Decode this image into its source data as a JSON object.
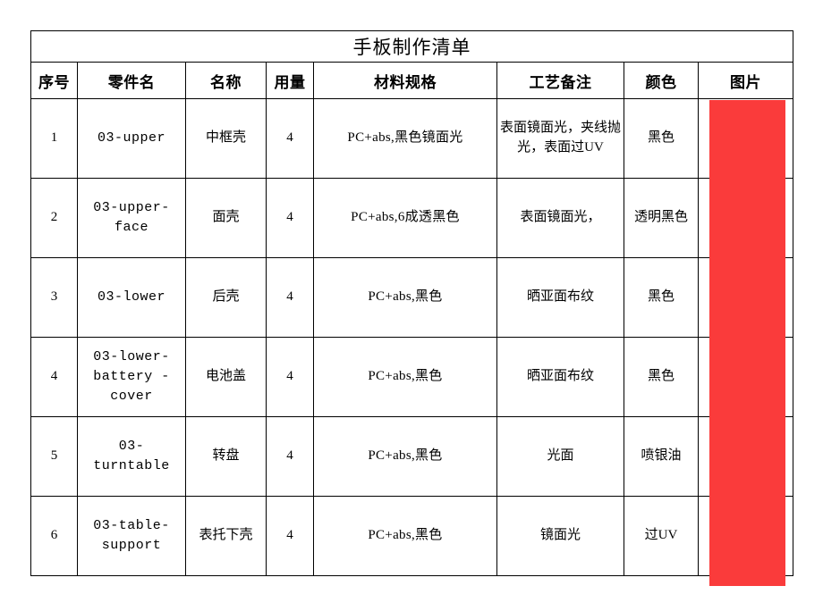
{
  "document": {
    "title": "手板制作清单"
  },
  "table": {
    "columns": [
      {
        "key": "index",
        "label": "序号",
        "name": "col-index"
      },
      {
        "key": "part_no",
        "label": "零件名",
        "name": "col-part-number"
      },
      {
        "key": "name",
        "label": "名称",
        "name": "col-name"
      },
      {
        "key": "qty",
        "label": "用量",
        "name": "col-quantity"
      },
      {
        "key": "material",
        "label": "材料规格",
        "name": "col-material-spec"
      },
      {
        "key": "process",
        "label": "工艺备注",
        "name": "col-process-note"
      },
      {
        "key": "color",
        "label": "颜色",
        "name": "col-color"
      },
      {
        "key": "picture",
        "label": "图片",
        "name": "col-picture"
      }
    ],
    "rows": [
      {
        "index": "1",
        "part_no": "03-upper",
        "name": "中框壳",
        "qty": "4",
        "material": "PC+abs,黑色镜面光",
        "process": "表面镜面光，夹线抛光，表面过UV",
        "color": "黑色",
        "picture": ""
      },
      {
        "index": "2",
        "part_no": "03-upper-face",
        "name": "面壳",
        "qty": "4",
        "material": "PC+abs,6成透黑色",
        "process": "表面镜面光，",
        "color": "透明黑色",
        "picture": ""
      },
      {
        "index": "3",
        "part_no": "03-lower",
        "name": "后壳",
        "qty": "4",
        "material": "PC+abs,黑色",
        "process": "晒亚面布纹",
        "color": "黑色",
        "picture": ""
      },
      {
        "index": "4",
        "part_no": "03-lower-\nbattery\n-cover",
        "name": "电池盖",
        "qty": "4",
        "material": "PC+abs,黑色",
        "process": "晒亚面布纹",
        "color": "黑色",
        "picture": ""
      },
      {
        "index": "5",
        "part_no": "03-\nturntable",
        "name": "转盘",
        "qty": "4",
        "material": "PC+abs,黑色",
        "process": "光面",
        "color": "喷银油",
        "picture": ""
      },
      {
        "index": "6",
        "part_no": "03-table-\nsupport",
        "name": "表托下壳",
        "qty": "4",
        "material": "PC+abs,黑色",
        "process": "镜面光",
        "color": "过UV",
        "picture": ""
      }
    ]
  },
  "image_block": {
    "name": "product-image-placeholder",
    "color": "#fa3b3b"
  },
  "colors": {
    "border": "#000000",
    "text": "#000000",
    "background": "#ffffff",
    "image_red": "#fa3b3b"
  }
}
